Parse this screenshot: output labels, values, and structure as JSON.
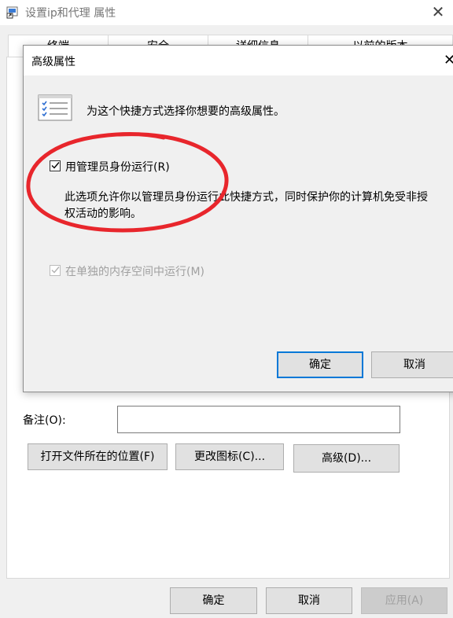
{
  "outer_window": {
    "title": "设置ip和代理 属性",
    "close_glyph": "✕",
    "app_icon": "shortcut-properties-icon",
    "tabs": [
      "终端",
      "安全",
      "详细信息",
      "以前的版本"
    ],
    "comment_label": "备注(O):",
    "comment_value": "",
    "open_location_button": "打开文件所在的位置(F)",
    "change_icon_button": "更改图标(C)...",
    "advanced_button": "高级(D)...",
    "ok_button": "确定",
    "cancel_button": "取消",
    "apply_button": "应用(A)"
  },
  "advanced_dialog": {
    "title": "高级属性",
    "close_glyph": "✕",
    "description": "为这个快捷方式选择你想要的高级属性。",
    "description_icon": "properties-list-icon",
    "run_as_admin": {
      "label": "用管理员身份运行(R)",
      "checked": true,
      "enabled": true
    },
    "run_as_admin_explanation": "此选项允许你以管理员身份运行此快捷方式，同时保护你的计算机免受非授权活动的影响。",
    "separate_memory": {
      "label": "在单独的内存空间中运行(M)",
      "checked": true,
      "enabled": false
    },
    "ok_button": "确定",
    "cancel_button": "取消"
  },
  "annotation": {
    "shape": "red-ellipse",
    "color": "#e8262c"
  },
  "colors": {
    "accent": "#0078d7",
    "disabled_text": "#a0a0a0",
    "window_bg": "#f0f0f0"
  }
}
